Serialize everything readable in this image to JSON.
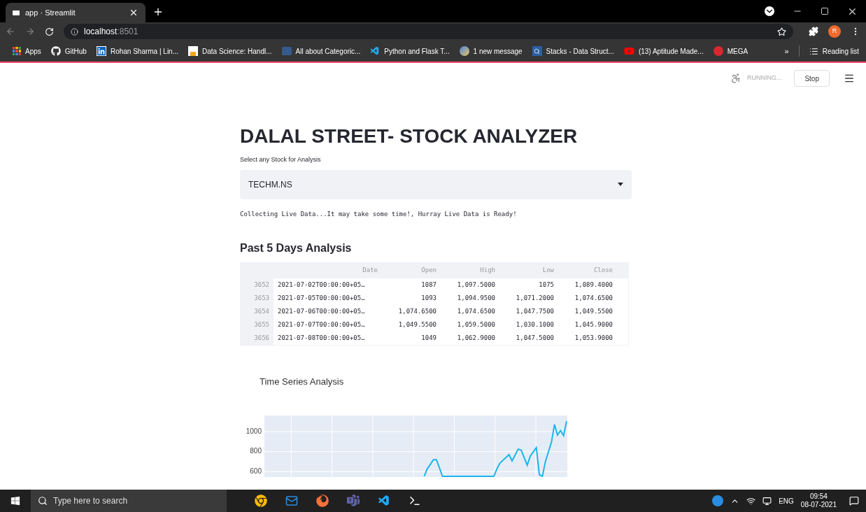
{
  "browser": {
    "tab": {
      "title": "app · Streamlit",
      "selected": true
    },
    "url_host": "localhost",
    "url_port": ":8501",
    "bookmarks": [
      {
        "label": "Apps",
        "kind": "apps"
      },
      {
        "label": "GitHub",
        "kind": "github"
      },
      {
        "label": "Rohan Sharma | Lin...",
        "kind": "linkedin"
      },
      {
        "label": "Data Science: Handl...",
        "kind": "doc"
      },
      {
        "label": "All about Categoric...",
        "kind": "tds"
      },
      {
        "label": "Python and Flask T...",
        "kind": "vscode"
      },
      {
        "label": "1 new message",
        "kind": "msg"
      },
      {
        "label": "Stacks - Data Struct...",
        "kind": "stack"
      },
      {
        "label": "(13) Aptitude Made...",
        "kind": "youtube"
      },
      {
        "label": "MEGA",
        "kind": "mega"
      }
    ],
    "overflow": "»",
    "reading_list": "Reading list",
    "profile_initial": "R"
  },
  "status": {
    "running": "RUNNING...",
    "stop": "Stop"
  },
  "title": "DALAL STREET- STOCK ANALYZER",
  "select": {
    "label": "Select any Stock for Analysis",
    "value": "TECHM.NS"
  },
  "message": "Collecting Live Data...It may take some time!, Hurray Live Data is Ready!",
  "section": "Past 5 Days Analysis",
  "table": {
    "columns": [
      "Date",
      "Open",
      "High",
      "Low",
      "Close"
    ],
    "rows": [
      {
        "index": "3652",
        "cells": [
          "2021-07-02T00:00:00+05…",
          "1087",
          "1,097.5000",
          "1075",
          "1,089.4000"
        ]
      },
      {
        "index": "3653",
        "cells": [
          "2021-07-05T00:00:00+05…",
          "1093",
          "1,094.9500",
          "1,071.2000",
          "1,074.6500"
        ]
      },
      {
        "index": "3654",
        "cells": [
          "2021-07-06T00:00:00+05…",
          "1,074.6500",
          "1,074.6500",
          "1,047.7500",
          "1,049.5500"
        ]
      },
      {
        "index": "3655",
        "cells": [
          "2021-07-07T00:00:00+05…",
          "1,049.5500",
          "1,059.5000",
          "1,030.1000",
          "1,045.9000"
        ]
      },
      {
        "index": "3656",
        "cells": [
          "2021-07-08T00:00:00+05…",
          "1049",
          "1,062.9000",
          "1,047.5000",
          "1,053.9000"
        ]
      }
    ]
  },
  "chart": {
    "title": "Time Series Analysis",
    "y_axis_labels": [
      "1000",
      "800",
      "600"
    ]
  },
  "taskbar": {
    "search_placeholder": "Type here to search",
    "lang": "ENG",
    "time": "09:54",
    "date": "08-07-2021"
  }
}
